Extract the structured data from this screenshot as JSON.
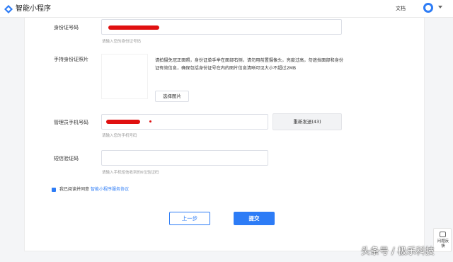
{
  "header": {
    "app_title": "智能小程序",
    "docs_link": "文档",
    "brand_color": "#2d7cf6"
  },
  "form": {
    "id_number": {
      "label": "身份证号码",
      "hint": "请输入您的身份证号码"
    },
    "id_photo": {
      "label": "手持身份证照片",
      "description": "请拍摄免冠正面照，身份证单手举在面部右侧，请勿用前置摄像头，亮度过高，勿遮挡面部和身份证有效信息，确保包括身份证号在内的图片信息清晰可见大小不超过2MB",
      "choose_button": "选择图片"
    },
    "phone": {
      "label": "管理员手机号码",
      "hint": "请输入您的手机号码",
      "resend_button": "重新发送(43)"
    },
    "sms_code": {
      "label": "短信验证码",
      "hint": "请输入手机短信收到的6位验证码",
      "value": ""
    },
    "agreement": {
      "checked": true,
      "text": "我已阅读并同意",
      "link": "智能小程序服务协议"
    },
    "buttons": {
      "prev": "上一步",
      "submit": "提交"
    }
  },
  "side": {
    "feedback": "问题反馈",
    "feedback_icon": "feedback-icon"
  },
  "watermark": "头条号 / 极乐科技"
}
